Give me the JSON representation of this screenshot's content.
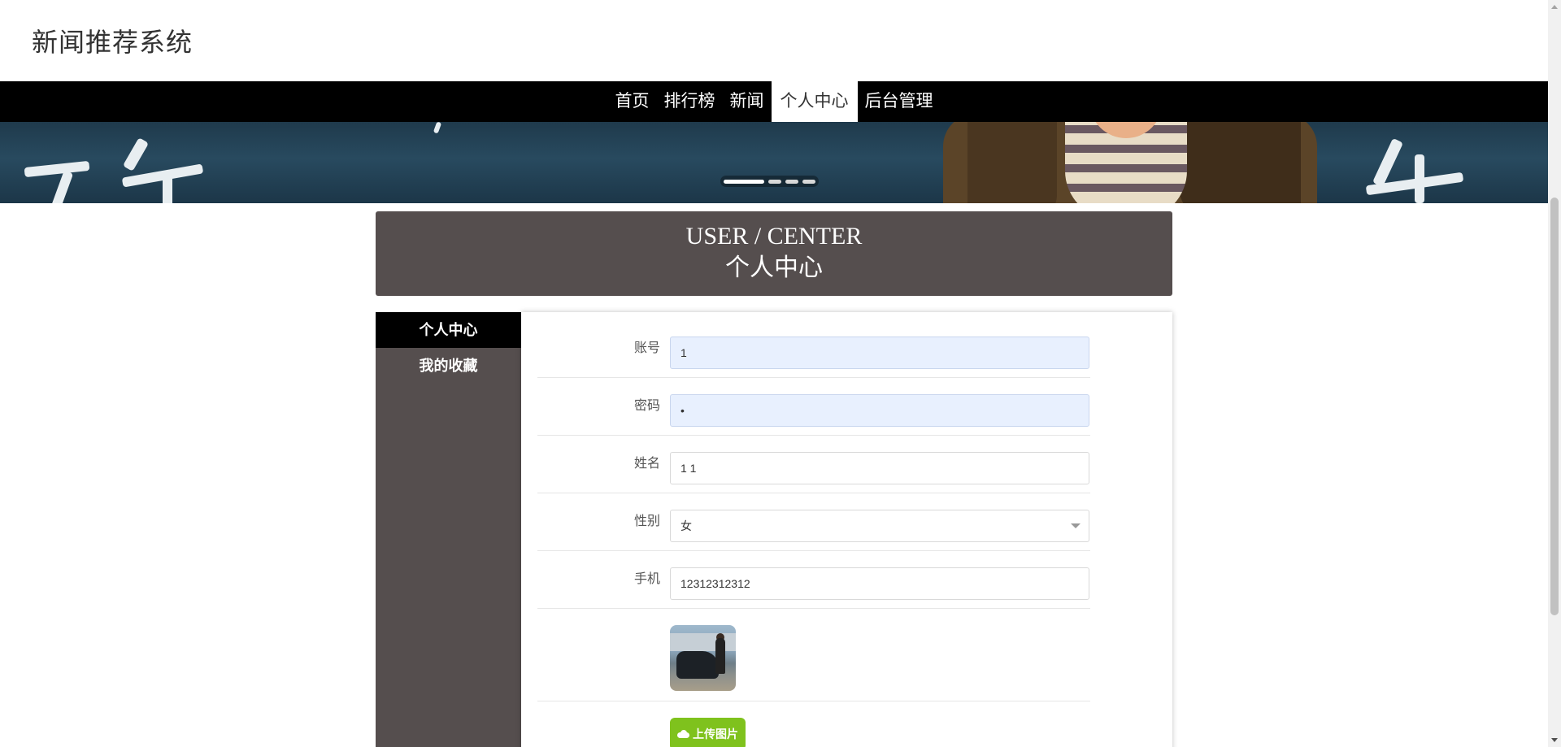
{
  "site": {
    "title": "新闻推荐系统"
  },
  "nav": {
    "items": [
      {
        "label": "首页"
      },
      {
        "label": "排行榜"
      },
      {
        "label": "新闻"
      },
      {
        "label": "个人中心",
        "active": true
      },
      {
        "label": "后台管理"
      }
    ]
  },
  "banner": {
    "slide_count": 4,
    "active_slide": 1
  },
  "section": {
    "title_en": "USER / CENTER",
    "title_cn": "个人中心"
  },
  "sidebar": {
    "items": [
      {
        "label": "个人中心",
        "active": true
      },
      {
        "label": "我的收藏"
      }
    ]
  },
  "form": {
    "account": {
      "label": "账号",
      "value": "1"
    },
    "password": {
      "label": "密码",
      "value": "•"
    },
    "name": {
      "label": "姓名",
      "value": "1 1"
    },
    "gender": {
      "label": "性别",
      "value": "女"
    },
    "phone": {
      "label": "手机",
      "value": "12312312312"
    },
    "upload_button": "上传图片"
  },
  "colors": {
    "navbar": "#000000",
    "panel_dark": "#554e4e",
    "autofill": "#e8f0fe",
    "upload": "#7fc21d"
  }
}
